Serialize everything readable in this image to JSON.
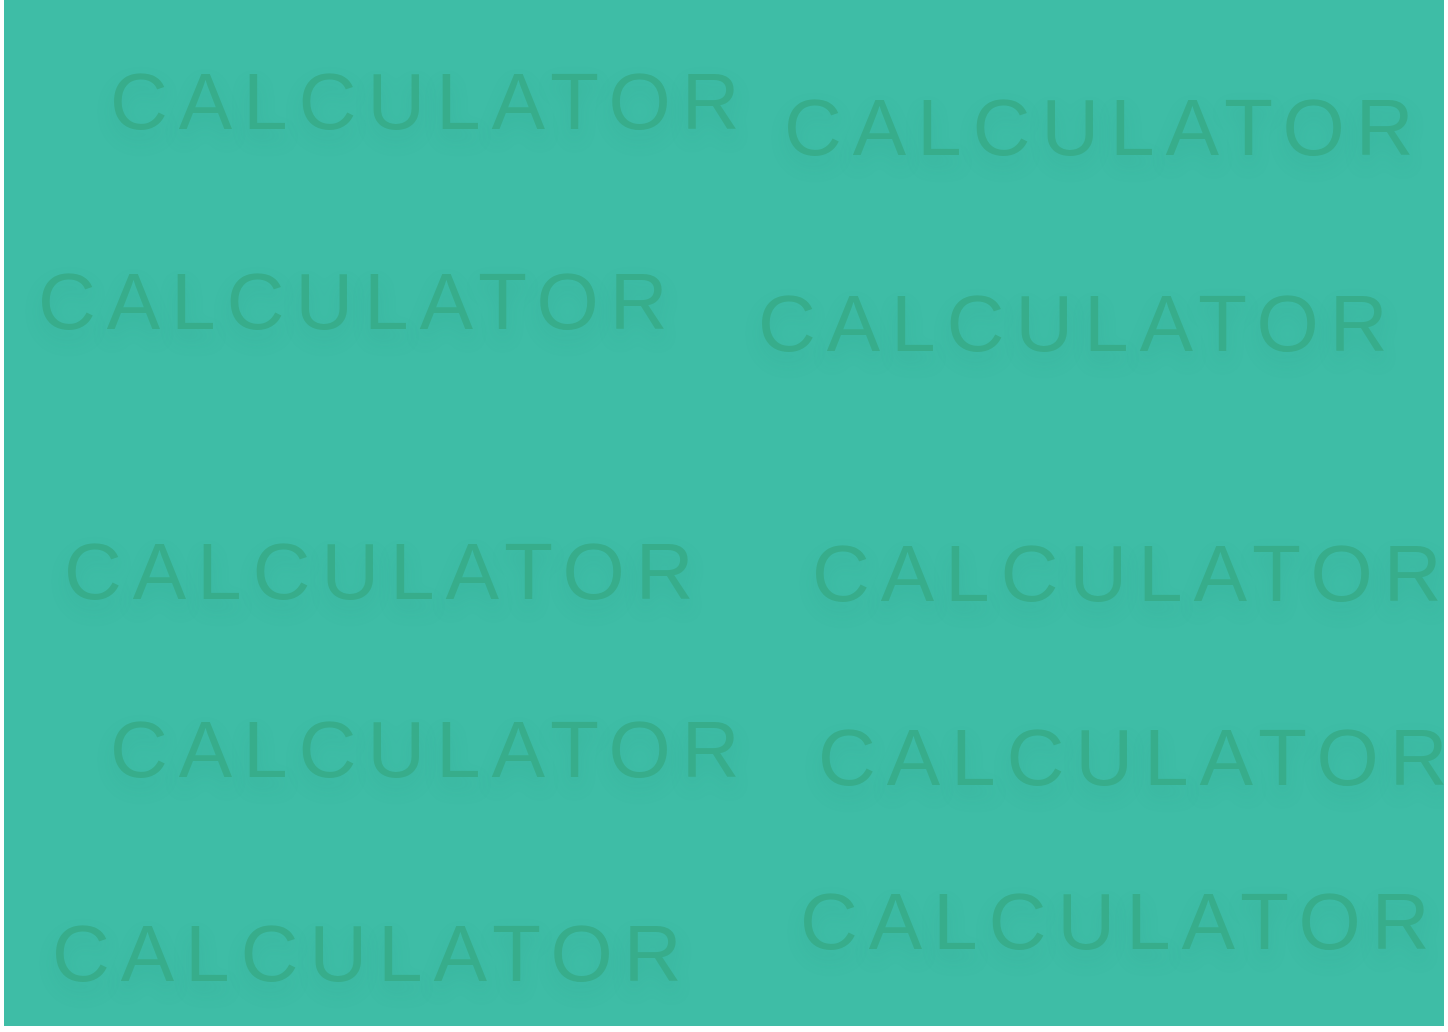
{
  "background_color": "#3ebda6",
  "text_color": "#37ad8b",
  "words": [
    "CALCULATOR",
    "CALCULATOR",
    "CALCULATOR",
    "CALCULATOR",
    "CALCULATOR",
    "CALCULATOR",
    "CALCULATOR",
    "CALCULATOR",
    "CALCULATOR",
    "CALCULATOR"
  ]
}
